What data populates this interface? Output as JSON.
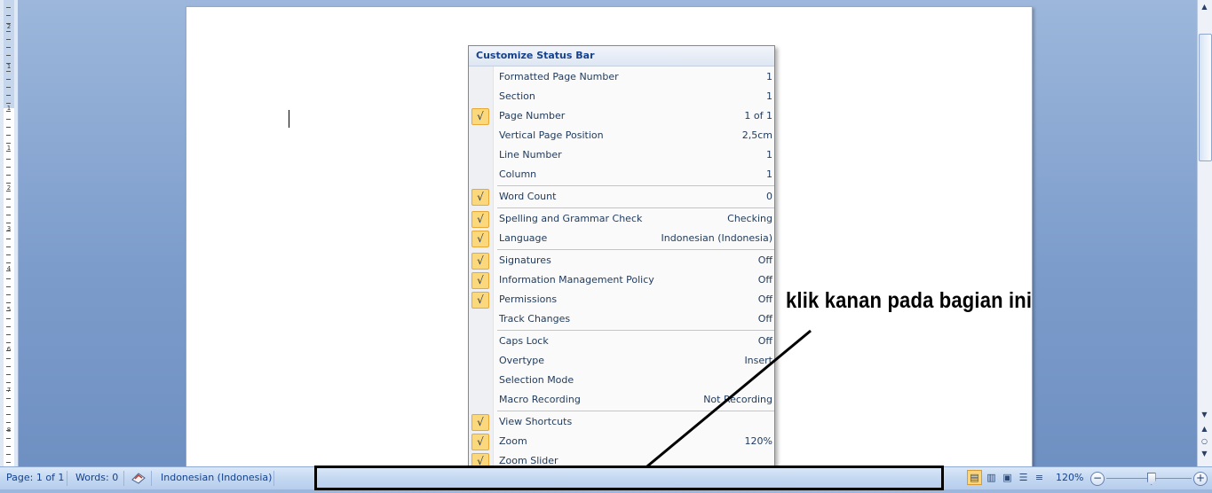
{
  "ruler": {
    "numbers": [
      "2",
      "1",
      "1",
      "1",
      "2",
      "3",
      "4",
      "5",
      "6",
      "7",
      "8"
    ]
  },
  "menu": {
    "title": "Customize Status Bar",
    "items": [
      {
        "label": "Formatted Page Number",
        "value": "1",
        "checked": false,
        "sep_after": false
      },
      {
        "label": "Section",
        "value": "1",
        "checked": false,
        "sep_after": false
      },
      {
        "label": "Page Number",
        "value": "1 of 1",
        "checked": true,
        "sep_after": false
      },
      {
        "label": "Vertical Page Position",
        "value": "2,5cm",
        "checked": false,
        "sep_after": false
      },
      {
        "label": "Line Number",
        "value": "1",
        "checked": false,
        "sep_after": false
      },
      {
        "label": "Column",
        "value": "1",
        "checked": false,
        "sep_after": true
      },
      {
        "label": "Word Count",
        "value": "0",
        "checked": true,
        "sep_after": true
      },
      {
        "label": "Spelling and Grammar Check",
        "value": "Checking",
        "checked": true,
        "sep_after": false
      },
      {
        "label": "Language",
        "value": "Indonesian (Indonesia)",
        "checked": true,
        "sep_after": true
      },
      {
        "label": "Signatures",
        "value": "Off",
        "checked": true,
        "sep_after": false
      },
      {
        "label": "Information Management Policy",
        "value": "Off",
        "checked": true,
        "sep_after": false
      },
      {
        "label": "Permissions",
        "value": "Off",
        "checked": true,
        "sep_after": false
      },
      {
        "label": "Track Changes",
        "value": "Off",
        "checked": false,
        "sep_after": true
      },
      {
        "label": "Caps Lock",
        "value": "Off",
        "checked": false,
        "sep_after": false
      },
      {
        "label": "Overtype",
        "value": "Insert",
        "checked": false,
        "sep_after": false
      },
      {
        "label": "Selection Mode",
        "value": "",
        "checked": false,
        "sep_after": false
      },
      {
        "label": "Macro Recording",
        "value": "Not Recording",
        "checked": false,
        "sep_after": true
      },
      {
        "label": "View Shortcuts",
        "value": "",
        "checked": true,
        "sep_after": false
      },
      {
        "label": "Zoom",
        "value": "120%",
        "checked": true,
        "sep_after": false
      },
      {
        "label": "Zoom Slider",
        "value": "",
        "checked": true,
        "sep_after": false
      }
    ],
    "check_glyph": "√"
  },
  "annotation": {
    "text": "klik kanan pada bagian ini"
  },
  "statusbar": {
    "page": "Page: 1 of 1",
    "words": "Words: 0",
    "language": "Indonesian (Indonesia)",
    "zoom": "120%",
    "zoom_level_percent": 120
  },
  "colors": {
    "accent": "#15428b",
    "check_bg": "#fcd87c",
    "background": "#7c9ccb"
  },
  "icons": {
    "proofing": "proofing-book-icon",
    "view_print": "print-layout-icon",
    "view_reading": "full-screen-reading-icon",
    "view_web": "web-layout-icon",
    "view_outline": "outline-icon",
    "view_draft": "draft-icon",
    "zoom_out": "zoom-out-icon",
    "zoom_in": "zoom-in-icon"
  }
}
